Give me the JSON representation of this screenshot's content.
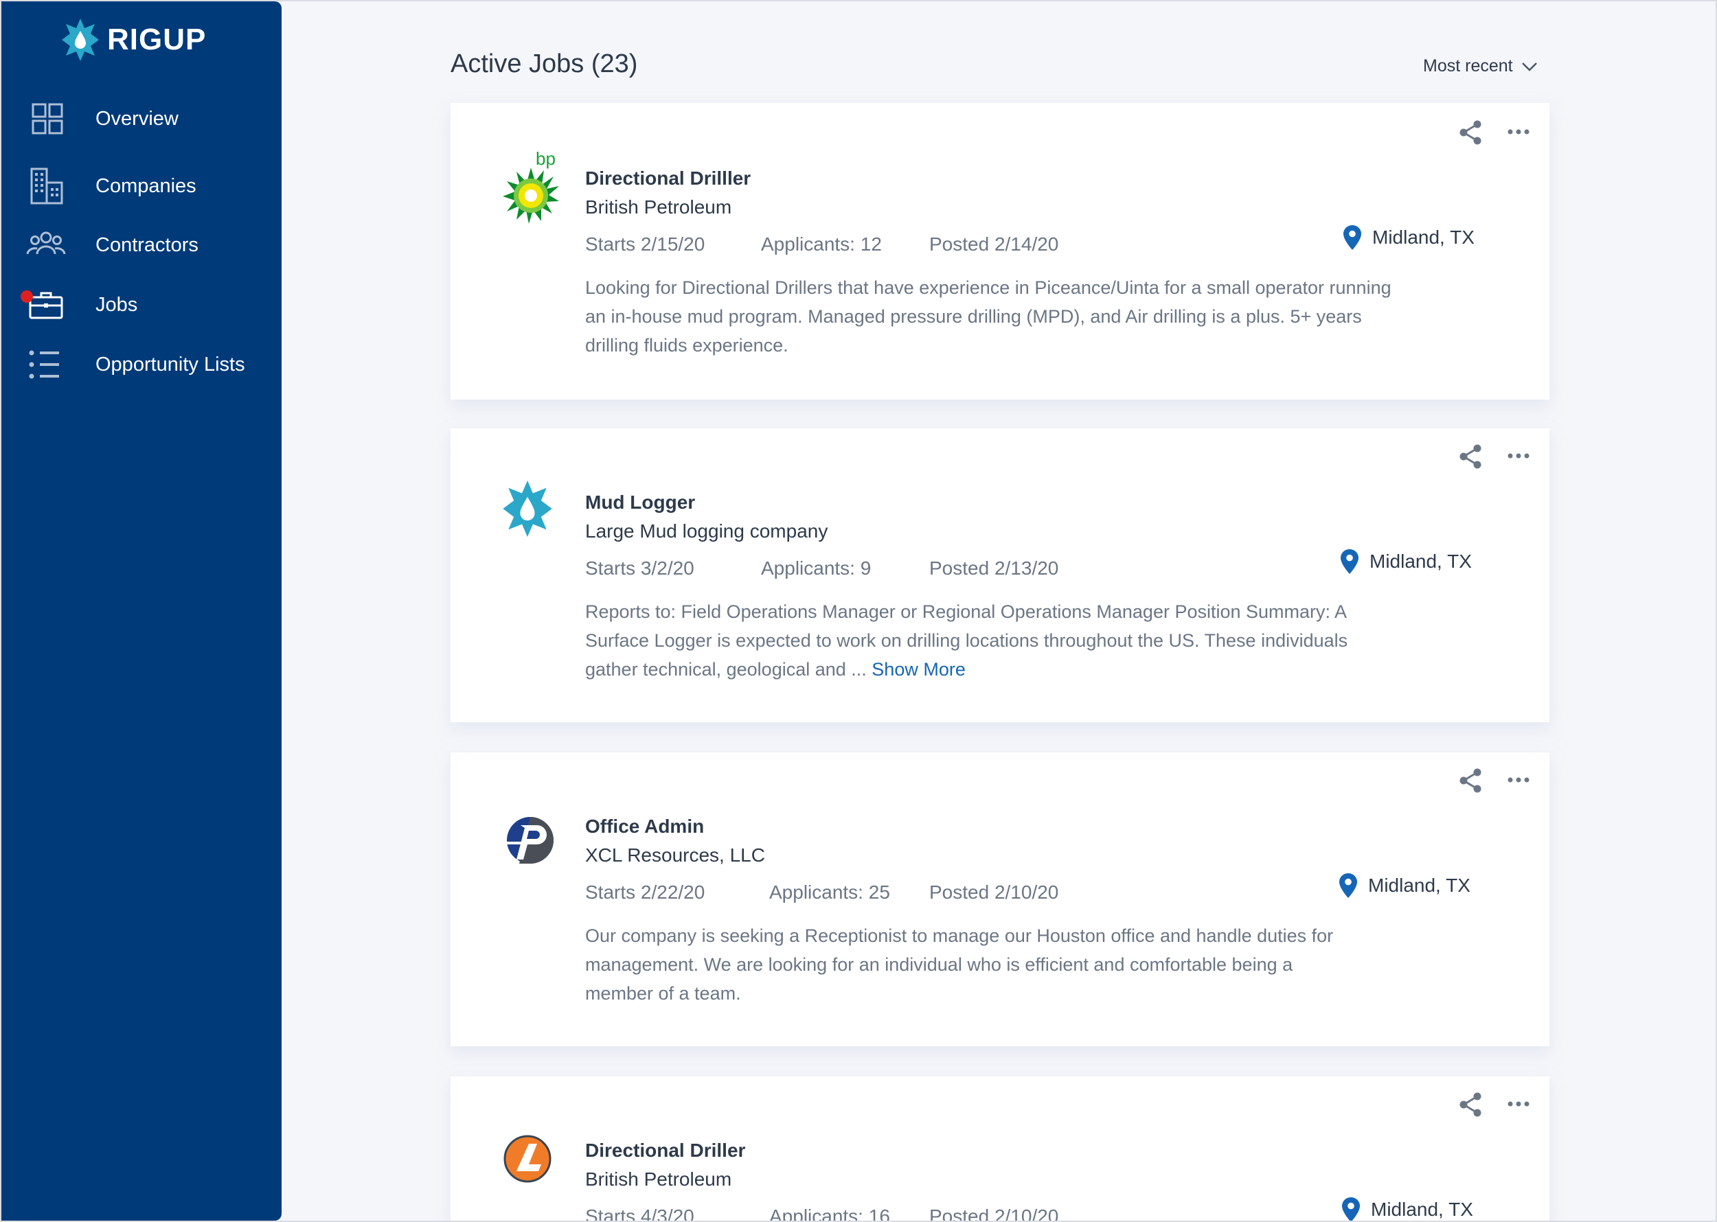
{
  "app": {
    "brand": "RIGUP"
  },
  "sidebar": {
    "items": [
      {
        "label": "Overview",
        "icon": "grid-icon"
      },
      {
        "label": "Companies",
        "icon": "building-icon"
      },
      {
        "label": "Contractors",
        "icon": "people-icon"
      },
      {
        "label": "Jobs",
        "icon": "briefcase-icon",
        "active": true,
        "notification": true
      },
      {
        "label": "Opportunity Lists",
        "icon": "list-icon"
      }
    ]
  },
  "header": {
    "title": "Active Jobs (23)",
    "sort_label": "Most recent"
  },
  "jobs": [
    {
      "title": "Directional Drilller",
      "company": "British Petroleum",
      "logo_text": "bp",
      "starts": "Starts 2/15/20",
      "applicants": "Applicants: 12",
      "posted": "Posted 2/14/20",
      "location": "Midland, TX",
      "description": "Looking for Directional Drillers that have experience in Piceance/Uinta for a small operator running an in-house mud program. Managed pressure drilling (MPD), and Air drilling is a plus. 5+ years drilling fluids experience."
    },
    {
      "title": "Mud Logger",
      "company": "Large Mud logging company",
      "starts": "Starts 3/2/20",
      "applicants": "Applicants: 9",
      "posted": "Posted 2/13/20",
      "location": "Midland, TX",
      "description": "Reports to: Field Operations Manager or Regional Operations Manager Position Summary: A Surface Logger is expected to work on drilling locations throughout the US. These individuals gather technical, geological and ...",
      "show_more": "Show More"
    },
    {
      "title": "Office Admin",
      "company": "XCL Resources, LLC",
      "starts": "Starts 2/22/20",
      "applicants": "Applicants: 25",
      "posted": "Posted 2/10/20",
      "location": "Midland, TX",
      "description": "Our company is seeking a Receptionist to manage our Houston office and handle duties for management. We are looking for an individual who is efficient and comfortable being a member of a team."
    },
    {
      "title": "Directional Driller",
      "company": "British Petroleum",
      "starts": "Starts 4/3/20",
      "applicants": "Applicants: 16",
      "posted": "Posted 2/10/20",
      "location": "Midland, TX"
    }
  ],
  "colors": {
    "sidebar": "#003a78",
    "accent": "#1566b7",
    "notification": "#e02020",
    "logo_teal": "#2aa7c9"
  }
}
